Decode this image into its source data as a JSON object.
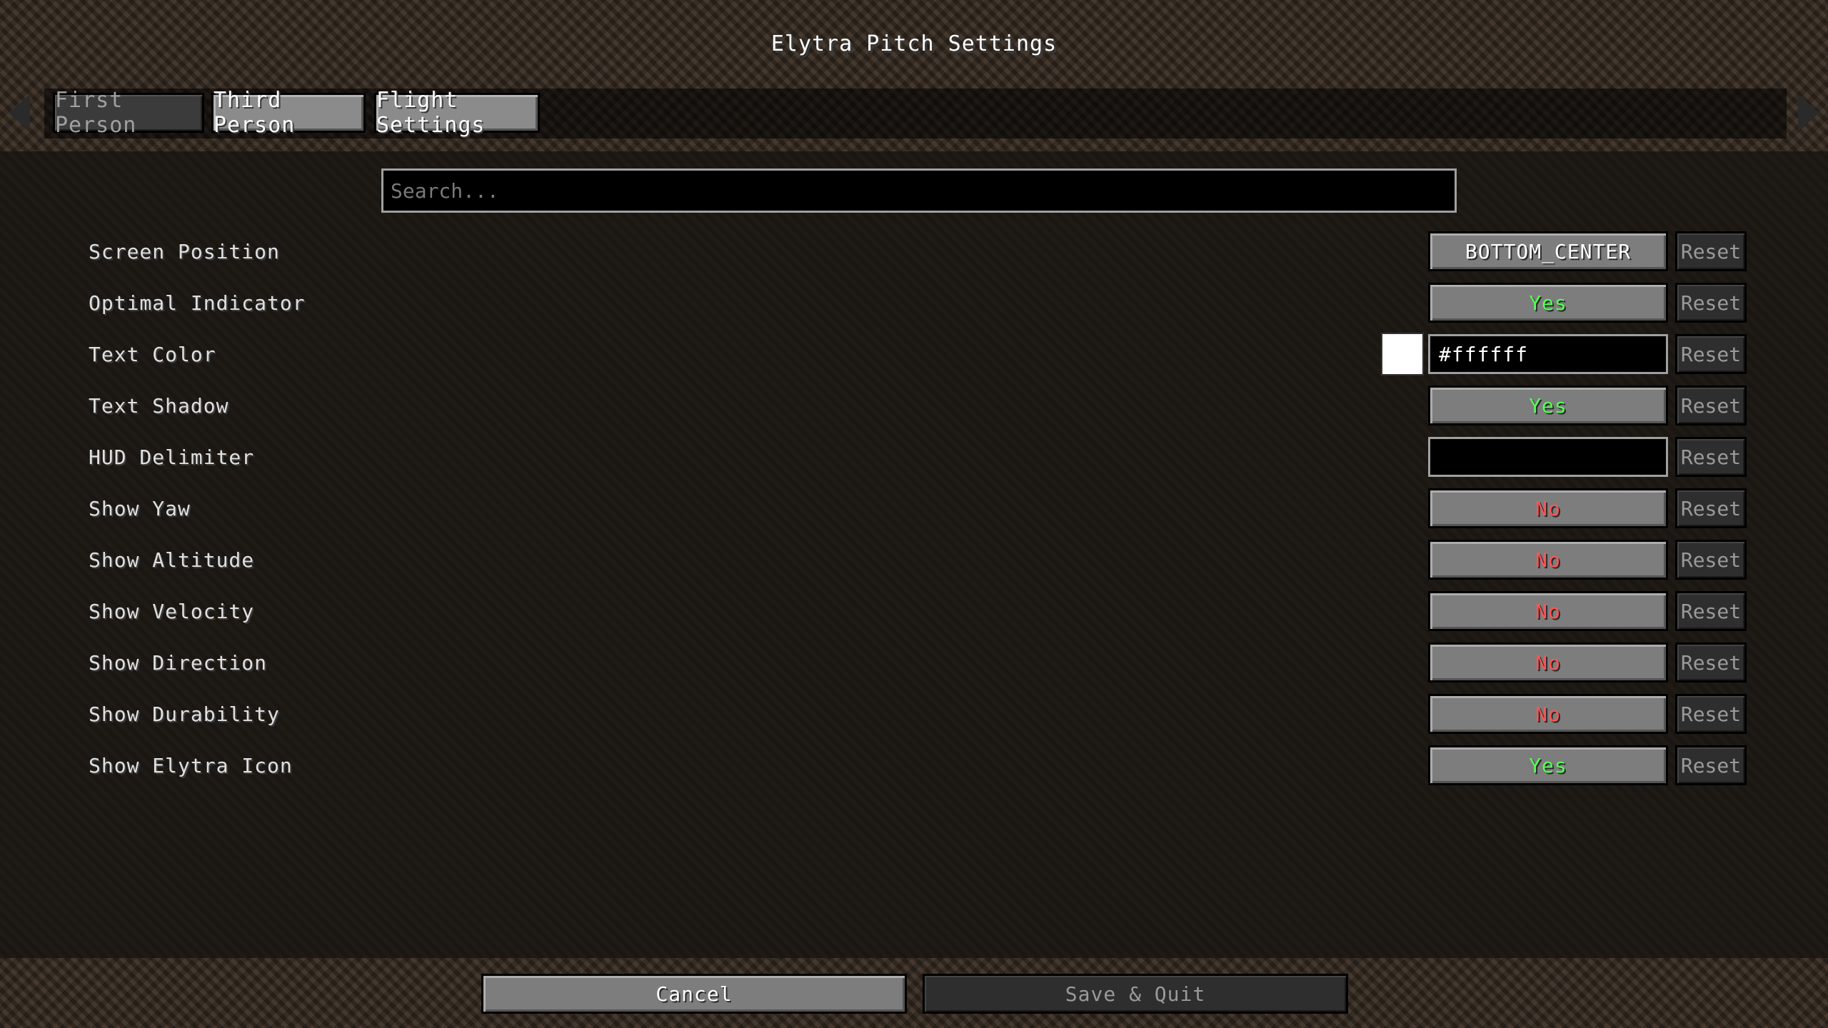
{
  "title": "Elytra Pitch Settings",
  "tabs": [
    {
      "label": "First Person",
      "state": "inactive"
    },
    {
      "label": "Third Person",
      "state": "active"
    },
    {
      "label": "Flight Settings",
      "state": "active"
    }
  ],
  "search": {
    "placeholder": "Search...",
    "value": ""
  },
  "settings": [
    {
      "label": "Screen Position",
      "value": "BOTTOM_CENTER",
      "kind": "enum",
      "reset": "Reset"
    },
    {
      "label": "Optimal Indicator",
      "value": "Yes",
      "kind": "yes",
      "reset": "Reset"
    },
    {
      "label": "Text Color",
      "value": "#ffffff",
      "kind": "color",
      "swatch": "#ffffff",
      "reset": "Reset"
    },
    {
      "label": "Text Shadow",
      "value": "Yes",
      "kind": "yes",
      "reset": "Reset"
    },
    {
      "label": "HUD Delimiter",
      "value": "",
      "kind": "text",
      "reset": "Reset"
    },
    {
      "label": "Show Yaw",
      "value": "No",
      "kind": "no",
      "reset": "Reset"
    },
    {
      "label": "Show Altitude",
      "value": "No",
      "kind": "no",
      "reset": "Reset"
    },
    {
      "label": "Show Velocity",
      "value": "No",
      "kind": "no",
      "reset": "Reset"
    },
    {
      "label": "Show Direction",
      "value": "No",
      "kind": "no",
      "reset": "Reset"
    },
    {
      "label": "Show Durability",
      "value": "No",
      "kind": "no",
      "reset": "Reset"
    },
    {
      "label": "Show Elytra Icon",
      "value": "Yes",
      "kind": "yes",
      "reset": "Reset"
    }
  ],
  "footer": {
    "cancel": "Cancel",
    "save_quit": "Save & Quit"
  },
  "colors": {
    "yes": "#55ff55",
    "no": "#ff5555",
    "enum": "#ffffff"
  }
}
